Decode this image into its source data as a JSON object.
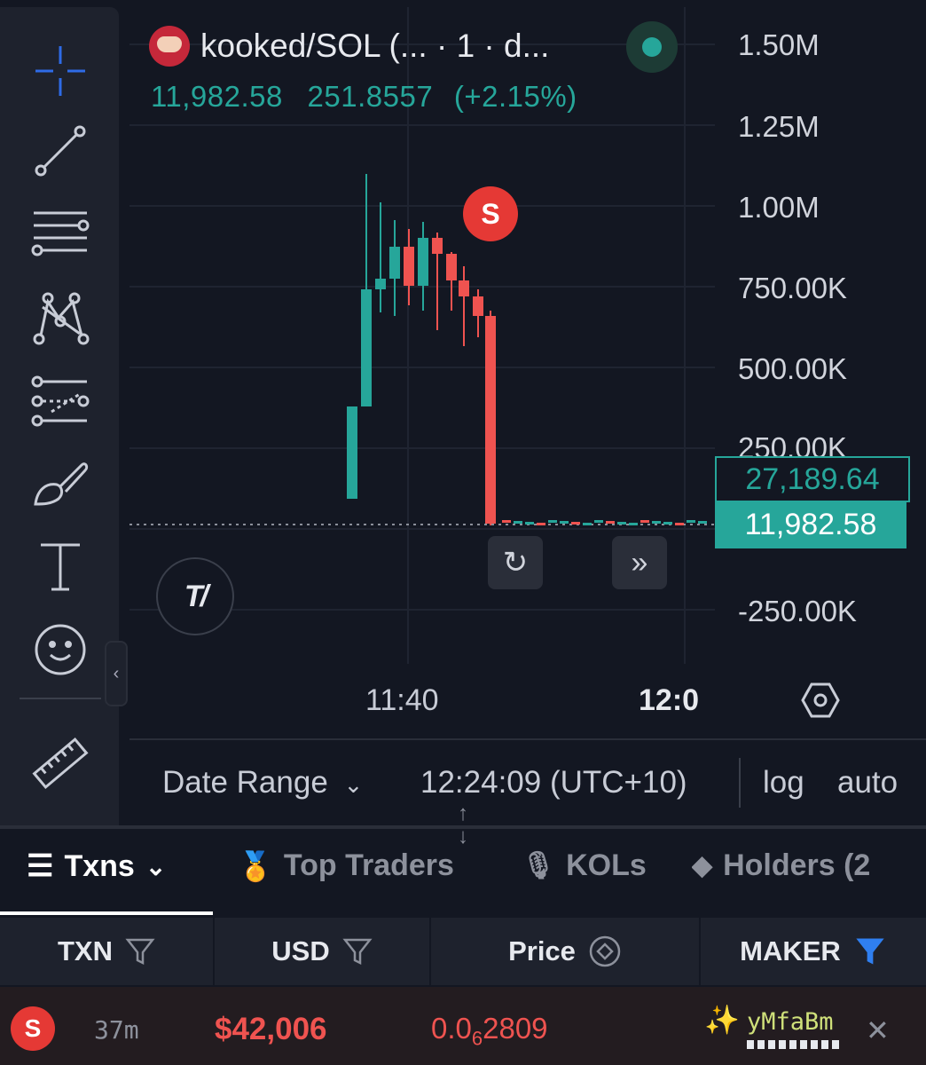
{
  "header": {
    "title": "kooked/SOL (... · 1 · d...",
    "price": "11,982.58",
    "change_value": "251.8557",
    "change_pct": "(+2.15%)"
  },
  "colors": {
    "up": "#26a69a",
    "down": "#ef5350",
    "background": "#131722",
    "panel": "#1e222d"
  },
  "price_axis": {
    "labels": [
      "1.50M",
      "1.25M",
      "1.00M",
      "750.00K",
      "500.00K",
      "250.00K",
      "-250.00K"
    ],
    "tag_outline": "27,189.64",
    "tag_current": "11,982.58"
  },
  "time_axis": {
    "labels": [
      "11:40",
      "12:0"
    ]
  },
  "chart_markers": {
    "sell": "S"
  },
  "chart_controls": {
    "reset_icon": "rotate-icon",
    "scroll_icon": "double-chevron-right-icon",
    "logo": "T/"
  },
  "bottom_bar": {
    "date_range": "Date Range",
    "clock": "12:24:09 (UTC+10)",
    "log": "log",
    "auto": "auto"
  },
  "toolbar": {
    "tools": [
      "crosshair-icon",
      "trendline-icon",
      "fib-retracement-icon",
      "pattern-icon",
      "prediction-icon",
      "brush-icon",
      "text-icon",
      "emoji-icon",
      "ruler-icon"
    ]
  },
  "tabs": [
    {
      "label": "Txns",
      "icon": "list-icon",
      "active": true
    },
    {
      "label": "Top Traders",
      "icon": "medal-icon"
    },
    {
      "label": "KOLs",
      "icon": "microphone-icon"
    },
    {
      "label": "Holders (2",
      "icon": "diamond-icon"
    }
  ],
  "table": {
    "columns": [
      "TXN",
      "USD",
      "Price",
      "MAKER"
    ],
    "rows": [
      {
        "type": "S",
        "age": "37m",
        "usd": "$42,006",
        "price_prefix": "0.0",
        "price_sub": "6",
        "price_rest": "2809",
        "maker": "yMfaBm"
      }
    ]
  }
}
